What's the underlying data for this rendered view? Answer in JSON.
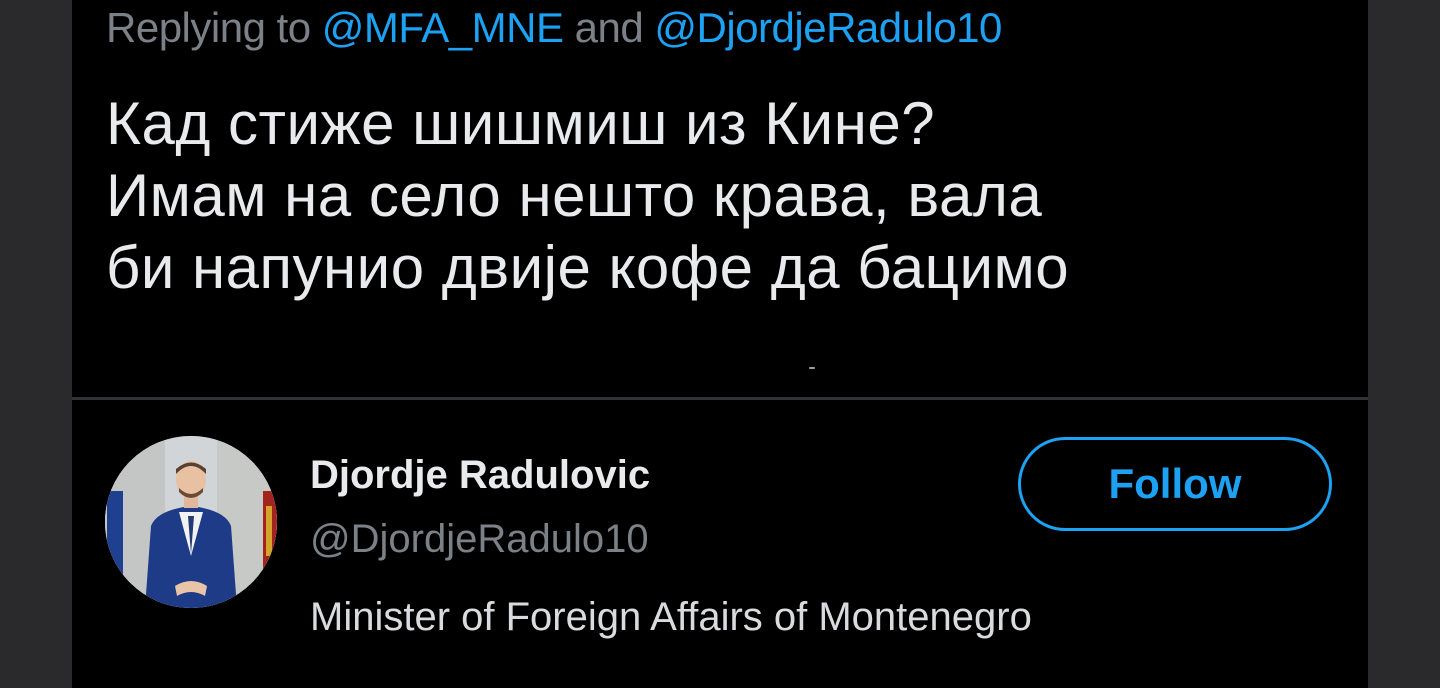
{
  "reply": {
    "prefix": "Replying to ",
    "mention_1": "@MFA_MNE",
    "joiner": " and ",
    "mention_2": "@DjordjeRadulo10"
  },
  "tweet": {
    "lines": [
      "Кад стиже шишмиш из Кине?",
      "Имам на село нешто крава, вала",
      "би напунио двије кофе да бацимо"
    ]
  },
  "profile": {
    "display_name": "Djordje Radulovic",
    "handle": "@DjordjeRadulo10",
    "bio": "Minister of Foreign Affairs of Montenegro",
    "follow_label": "Follow"
  },
  "colors": {
    "background": "#000000",
    "accent": "#1da1f2",
    "muted_text": "#7b8187",
    "primary_text": "#e8eaec"
  }
}
